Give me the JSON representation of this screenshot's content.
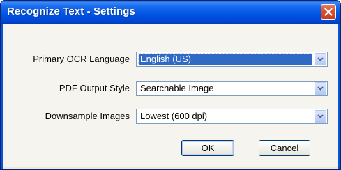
{
  "dialog": {
    "title": "Recognize Text - Settings"
  },
  "settings": {
    "primary_ocr_language": {
      "label": "Primary OCR Language",
      "value": "English (US)"
    },
    "pdf_output_style": {
      "label": "PDF Output Style",
      "value": "Searchable Image"
    },
    "downsample_images": {
      "label": "Downsample Images",
      "value": "Lowest (600 dpi)"
    }
  },
  "buttons": {
    "ok_label": "OK",
    "cancel_label": "Cancel"
  },
  "icons": {
    "close": "close-icon",
    "dropdown": "chevron-down-icon"
  },
  "colors": {
    "titlebar": "#0055e5",
    "close_button": "#d9502e",
    "selection": "#316ac5",
    "dialog_background": "#f5f4ef"
  }
}
